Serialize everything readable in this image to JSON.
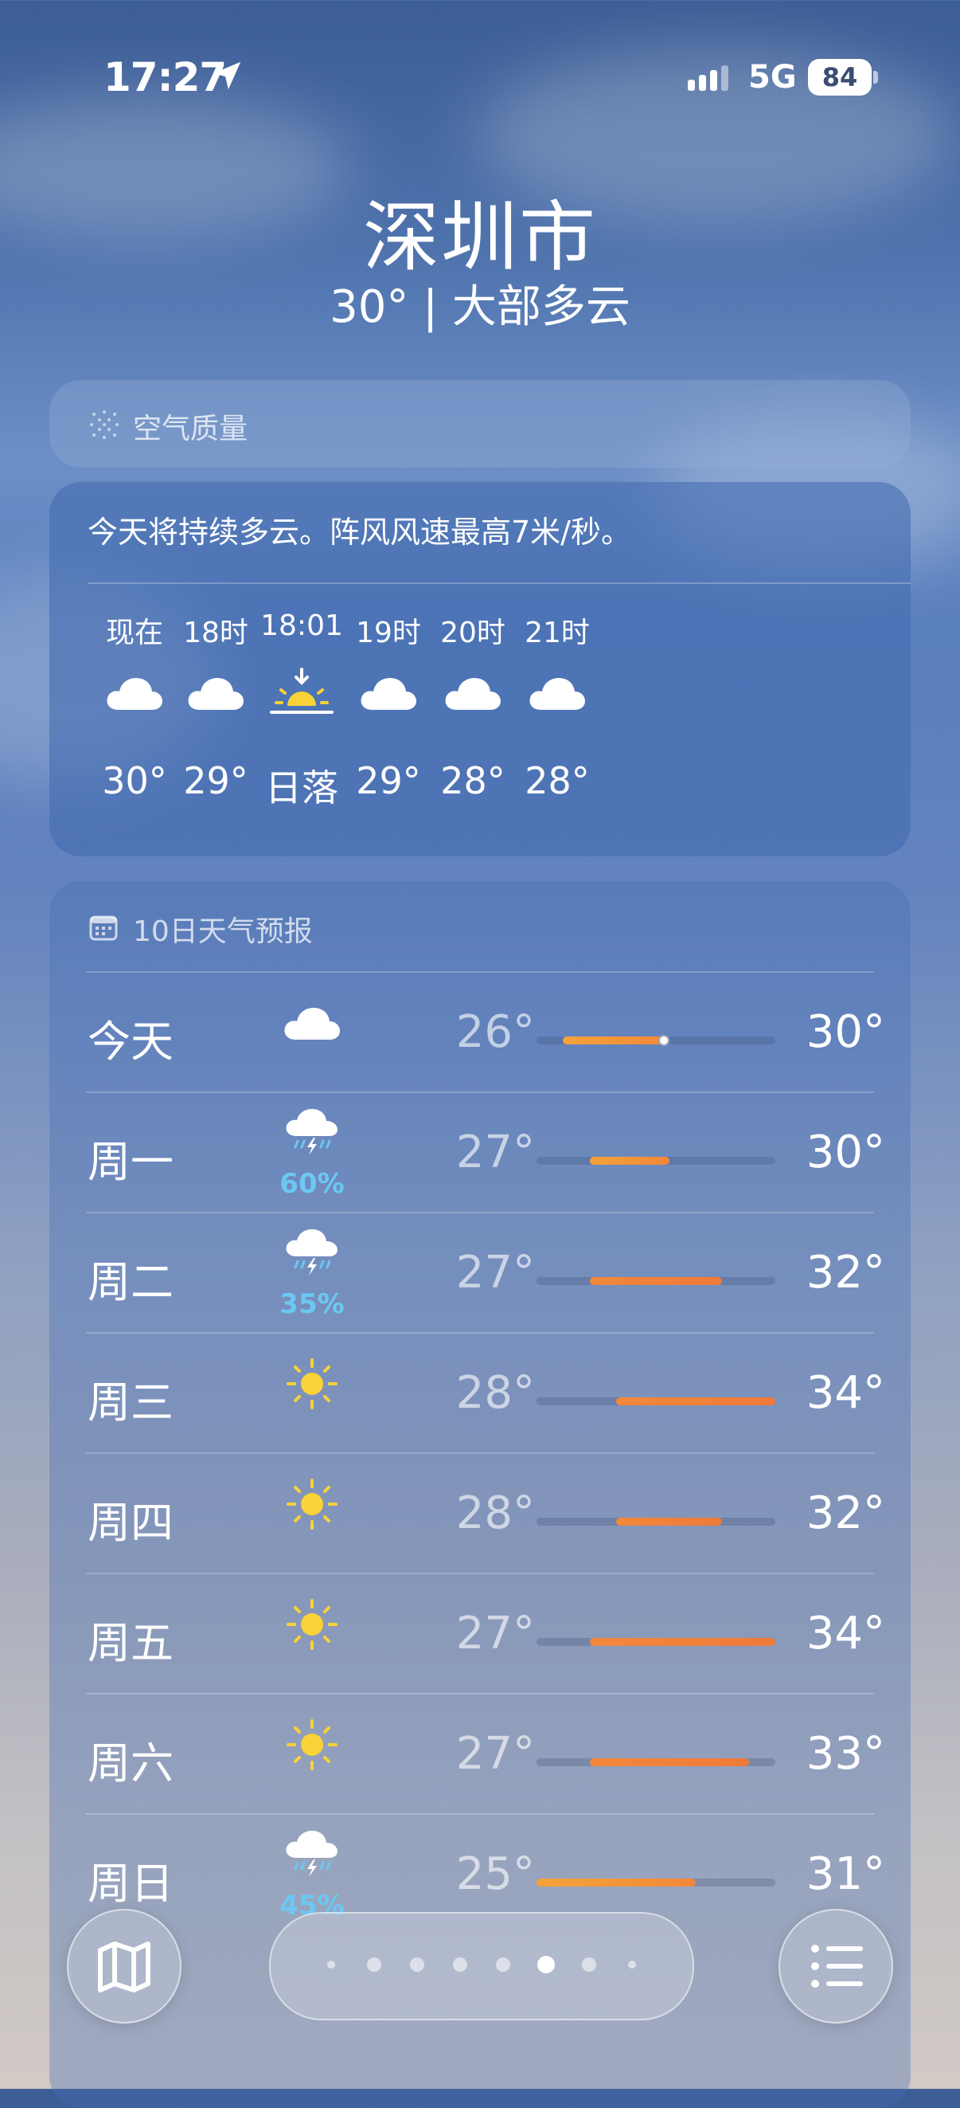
{
  "status_bar": {
    "time": "17:27",
    "network": "5G",
    "battery": "84"
  },
  "header": {
    "city": "深圳市",
    "summary": "30° | 大部多云"
  },
  "air_quality": {
    "label": "空气质量"
  },
  "hourly": {
    "description": "今天将持续多云。阵风风速最高7米/秒。",
    "items": [
      {
        "label": "现在",
        "icon": "cloud-icon",
        "temp": "30°"
      },
      {
        "label": "18时",
        "icon": "cloud-icon",
        "temp": "29°"
      },
      {
        "label": "18:01",
        "icon": "sunset-icon",
        "temp": "日落"
      },
      {
        "label": "19时",
        "icon": "cloud-icon",
        "temp": "29°"
      },
      {
        "label": "20时",
        "icon": "cloud-icon",
        "temp": "28°"
      },
      {
        "label": "21时",
        "icon": "cloud-icon",
        "temp": "28°"
      }
    ]
  },
  "forecast": {
    "title": "10日天气预报",
    "range_scale": [
      25,
      34
    ],
    "days": [
      {
        "day": "今天",
        "icon": "cloud-icon",
        "pct": "",
        "low": "26°",
        "high": "30°",
        "range": [
          26,
          30
        ],
        "current": 30
      },
      {
        "day": "周一",
        "icon": "thunderstorm-icon",
        "pct": "60%",
        "low": "27°",
        "high": "30°",
        "range": [
          27,
          30
        ]
      },
      {
        "day": "周二",
        "icon": "thunderstorm-icon",
        "pct": "35%",
        "low": "27°",
        "high": "32°",
        "range": [
          27,
          32
        ]
      },
      {
        "day": "周三",
        "icon": "sun-icon",
        "pct": "",
        "low": "28°",
        "high": "34°",
        "range": [
          28,
          34
        ]
      },
      {
        "day": "周四",
        "icon": "sun-icon",
        "pct": "",
        "low": "28°",
        "high": "32°",
        "range": [
          28,
          32
        ]
      },
      {
        "day": "周五",
        "icon": "sun-icon",
        "pct": "",
        "low": "27°",
        "high": "34°",
        "range": [
          27,
          34
        ]
      },
      {
        "day": "周六",
        "icon": "sun-icon",
        "pct": "",
        "low": "27°",
        "high": "33°",
        "range": [
          27,
          33
        ]
      },
      {
        "day": "周日",
        "icon": "thunderstorm-icon",
        "pct": "45%",
        "low": "25°",
        "high": "31°",
        "range": [
          25,
          31
        ]
      }
    ]
  },
  "pager": {
    "page_count": 8,
    "active_index": 5
  },
  "colors": {
    "range_cool": "#f5a33a",
    "range_warm": "#ef7a3a",
    "precip": "#6cc8f3"
  }
}
